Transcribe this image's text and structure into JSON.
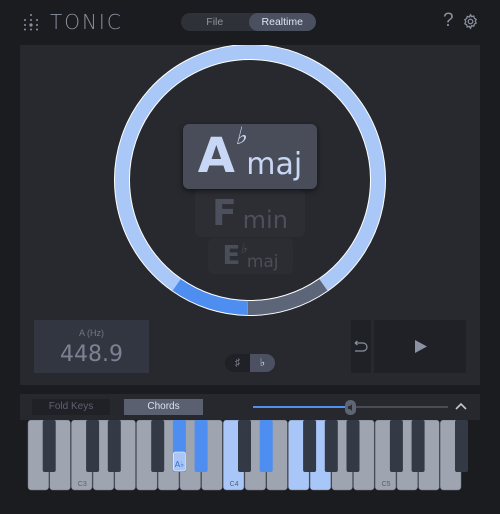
{
  "header": {
    "app_title": "TONIC",
    "mode_tabs": [
      {
        "label": "File",
        "active": false
      },
      {
        "label": "Realtime",
        "active": true
      }
    ],
    "help_icon": "?",
    "settings_icon": "gear-icon"
  },
  "detection": {
    "progress_ring": {
      "confidence_segments": [
        "light-blue",
        "gray",
        "blue",
        "light-blue"
      ],
      "colors": {
        "ring": "#aac8f7",
        "gray": "#5d6678",
        "blue": "#4d8ef0"
      }
    },
    "chords": [
      {
        "root": "A",
        "accidental": "♭",
        "quality": "maj",
        "rank": 1
      },
      {
        "root": "F",
        "accidental": "",
        "quality": "min",
        "rank": 2
      },
      {
        "root": "E",
        "accidental": "♭",
        "quality": "maj",
        "rank": 3
      }
    ]
  },
  "tuning": {
    "label": "A (Hz)",
    "value": "448.9"
  },
  "accidental_toggle": {
    "sharp": "♯",
    "flat": "♭",
    "selected": "flat"
  },
  "transport": {
    "loop_icon": "loop-back-icon",
    "play_icon": "play-icon"
  },
  "keyboard_bar": {
    "fold_keys_label": "Fold Keys",
    "chords_label": "Chords",
    "chords_active": true,
    "volume_percent": 48,
    "collapse_icon": "chevron-up-icon"
  },
  "keyboard": {
    "octave_labels": [
      "C3",
      "C4",
      "C5"
    ],
    "root_note_label": "A♭",
    "highlighted_keys": {
      "strong": [
        "Ab3",
        "C4",
        "Eb4"
      ],
      "light": [
        "Bb3",
        "C4",
        "F4",
        "G4"
      ]
    },
    "colors": {
      "strong": "#4d8ef0",
      "light": "#a8c7f8",
      "white": "#9fa4b1",
      "black": "#343946"
    }
  }
}
